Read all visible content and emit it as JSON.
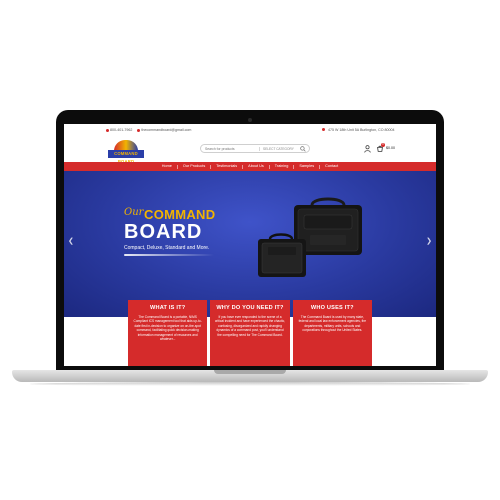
{
  "topbar": {
    "phone": "800-401-7962",
    "email": "thecommandboard@gmail.com",
    "address": "475 W 18th Unit 5A Burlington, CO 80004"
  },
  "header": {
    "logo_text": "COMMAND BOARD",
    "search_placeholder": "Search for products",
    "search_category": "SELECT CATEGORY",
    "cart_count": "0",
    "cart_total": "$0.00"
  },
  "nav": {
    "items": [
      "Home",
      "Our Products",
      "Testimonials",
      "About Us",
      "Training",
      "Samples",
      "Contact"
    ]
  },
  "hero": {
    "our": "Our",
    "command": "COMMAND",
    "board": "BOARD",
    "subtitle": "Compact, Deluxe, Standard and More."
  },
  "cards": [
    {
      "title": "WHAT IS IT?",
      "text": "The Command Board is a portable, NIMS Compliant ICS management tool that aids up-to-date first in-decision to organize on on-the-spot command, facilitating quick decision-making information management of resources and whatever..."
    },
    {
      "title": "WHY DO YOU NEED IT?",
      "text": "If you have ever responded to the scene of a critical incident and have experienced the chaotic, confusing, disorganized and rapidly changing dynamics of a command post, you'll understand the compelling need for The Command Board."
    },
    {
      "title": "WHO USES IT?",
      "text": "The Command Board is used by many state, federal and local law enforcement agencies, fire departments, military units, schools and corporations throughout the United States."
    }
  ],
  "colors": {
    "brand_red": "#d52b2b",
    "brand_blue": "#2a3aa0",
    "brand_gold": "#f2b400"
  }
}
